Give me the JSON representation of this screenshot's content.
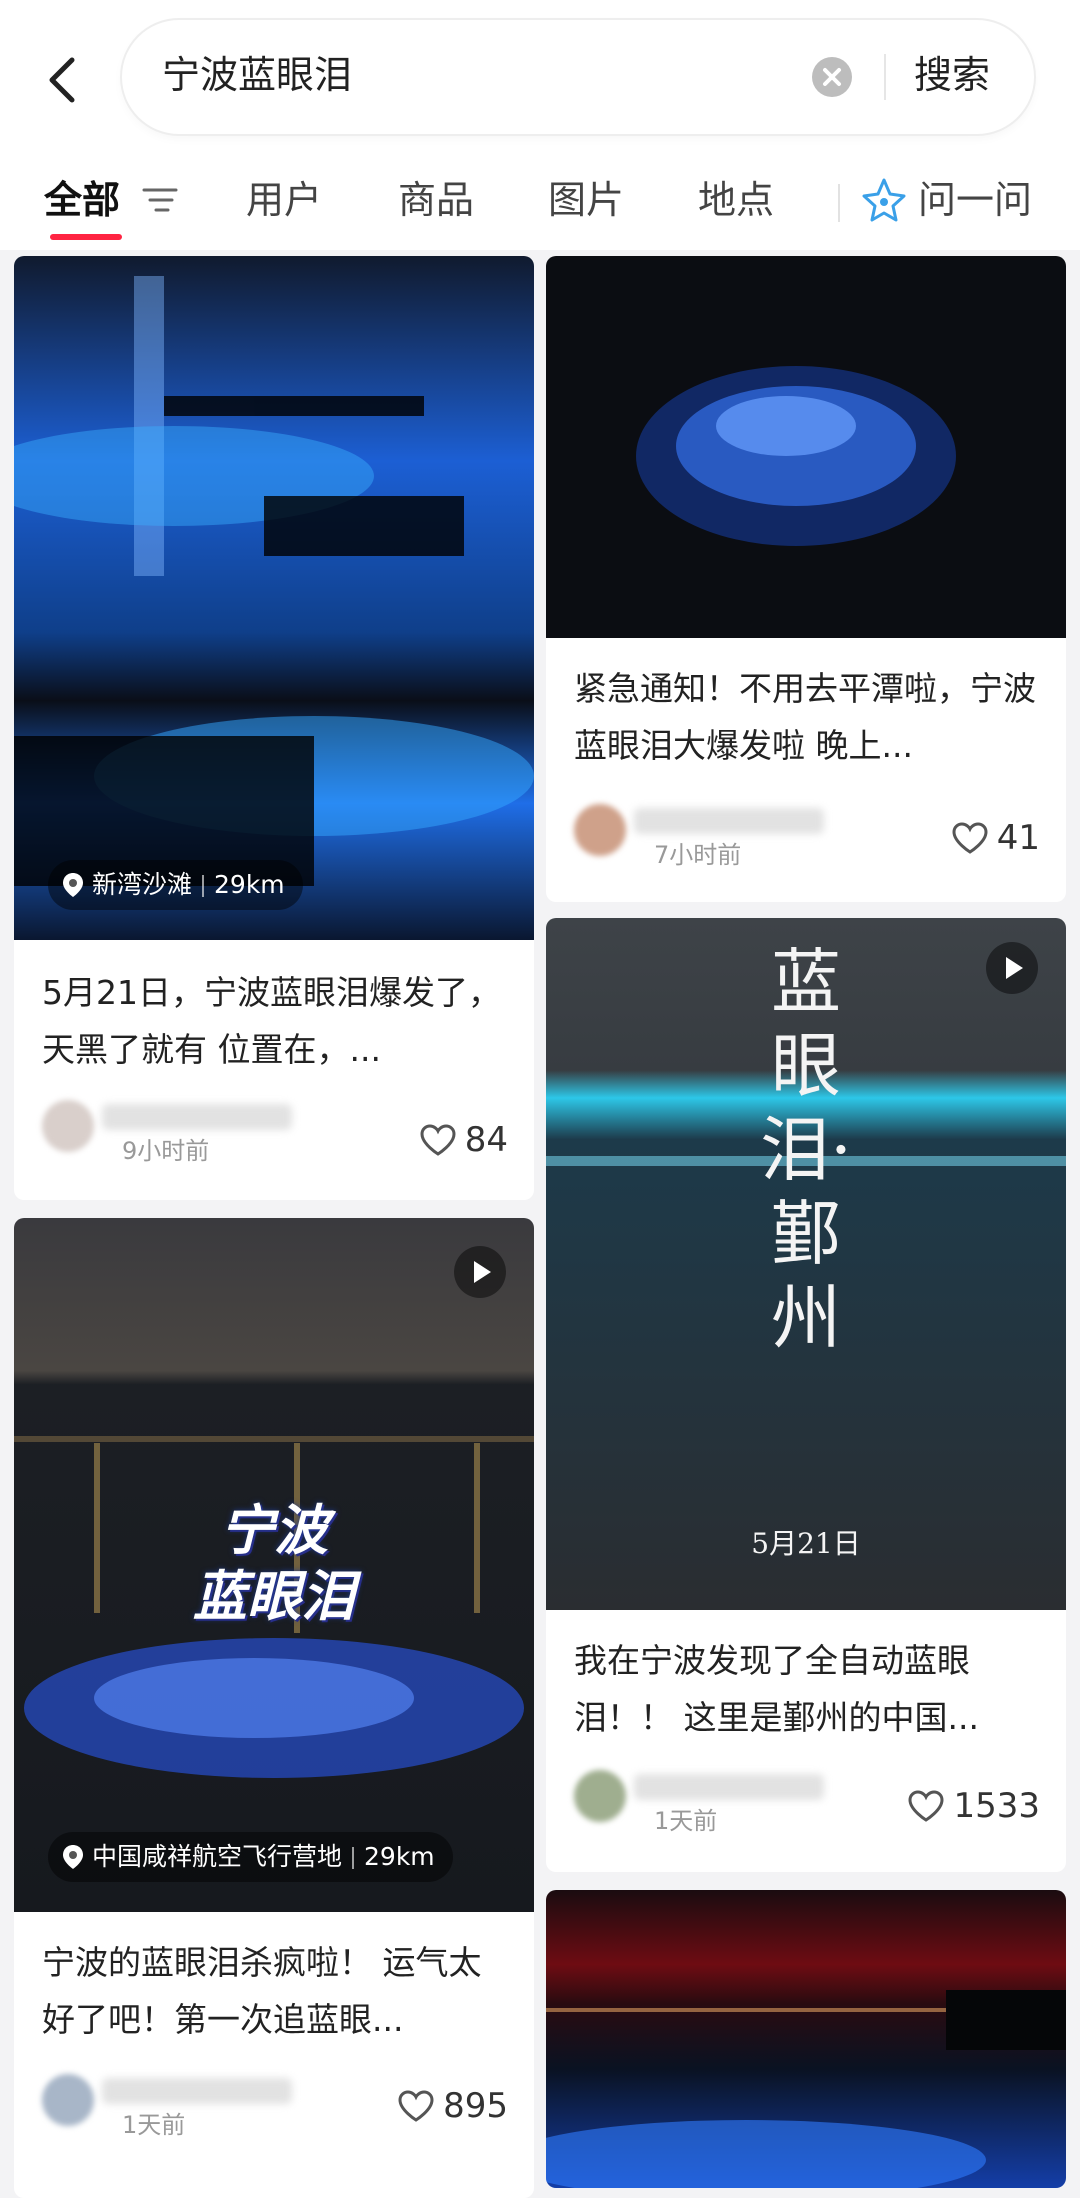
{
  "search": {
    "query": "宁波蓝眼泪",
    "button": "搜索"
  },
  "tabs": [
    {
      "label": "全部"
    },
    {
      "label": "用户"
    },
    {
      "label": "商品"
    },
    {
      "label": "图片"
    },
    {
      "label": "地点"
    },
    {
      "label": "问一问"
    }
  ],
  "cards": [
    {
      "title": "5月21日，宁波蓝眼泪爆发了，天黑了就有 位置在，...",
      "location": "新湾沙滩",
      "distance": "29km",
      "time": "9小时前",
      "likes": "84"
    },
    {
      "title": "紧急通知！不用去平潭啦，宁波蓝眼泪大爆发啦 晚上...",
      "time": "7小时前",
      "likes": "41"
    },
    {
      "title": "宁波的蓝眼泪杀疯啦！ 运气太好了吧！第一次追蓝眼...",
      "location": "中国咸祥航空飞行营地",
      "distance": "29km",
      "time": "1天前",
      "likes": "895",
      "overlay_line1": "宁波",
      "overlay_line2": "蓝眼泪"
    },
    {
      "title": "我在宁波发现了全自动蓝眼泪！！ 这里是鄞州的中国...",
      "time": "1天前",
      "likes": "1533",
      "overlay_vertical": "蓝眼泪·鄞州",
      "overlay_date": "5月21日"
    }
  ]
}
